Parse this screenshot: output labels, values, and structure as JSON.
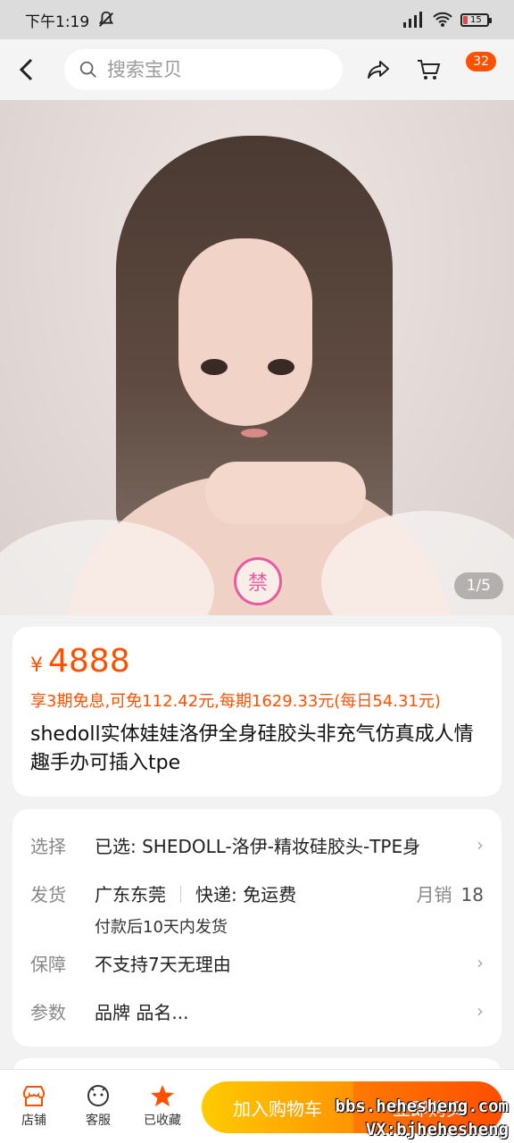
{
  "status": {
    "time": "下午1:19",
    "battery": "15"
  },
  "header": {
    "search_placeholder": "搜索宝贝",
    "cart_badge": "32"
  },
  "gallery": {
    "counter": "1/5",
    "stamp": "禁"
  },
  "product": {
    "currency": "¥",
    "price": "4888",
    "installment": "享3期免息,可免112.42元,每期1629.33元(每日54.31元)",
    "title": "shedoll实体娃娃洛伊全身硅胶头非充气仿真成人情趣手办可插入tpe"
  },
  "details": {
    "select": {
      "label": "选择",
      "value": "已选: SHEDOLL-洛伊-精妆硅胶头-TPE身"
    },
    "ship": {
      "label": "发货",
      "origin": "广东东莞",
      "express": "快递: 免运费",
      "sales_label": "月销",
      "sales_value": "18",
      "note": "付款后10天内发货"
    },
    "guarantee": {
      "label": "保障",
      "value": "不支持7天无理由"
    },
    "params": {
      "label": "参数",
      "value": "品牌 品名..."
    }
  },
  "bottom": {
    "store": "店铺",
    "service": "客服",
    "favorite": "已收藏",
    "add_cart": "加入购物车",
    "buy_now": "立即购买"
  },
  "watermark": {
    "line1": "bbs.hehesheng.com",
    "line2": "VX:bjhehesheng"
  },
  "colors": {
    "accent": "#ff5000",
    "cart_btn": "#ffb000",
    "buy_btn": "#ff5a00"
  }
}
